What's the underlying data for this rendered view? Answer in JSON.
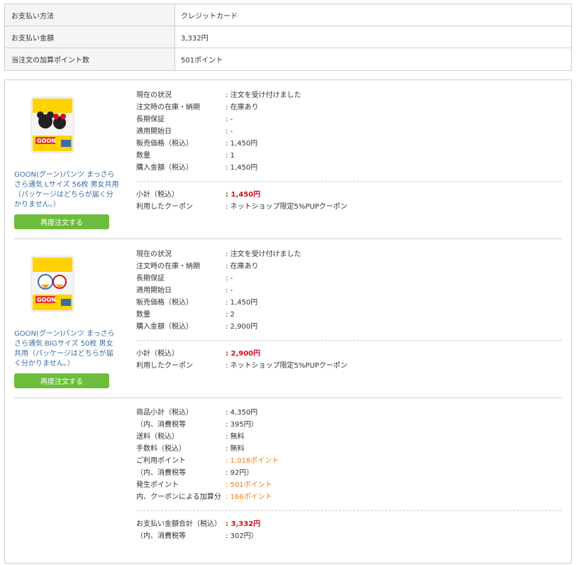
{
  "payment": [
    {
      "label": "お支払い方法",
      "value": "クレジットカード"
    },
    {
      "label": "お支払い金額",
      "value": "3,332円"
    },
    {
      "label": "当注文の加算ポイント数",
      "value": "501ポイント"
    }
  ],
  "items": [
    {
      "name": "GOON(グーン)パンツ まっさらさら通気 Lサイズ 56枚 男女共用（パッケージはどちらが届く分かりません。）",
      "reorder": "再度注文する",
      "rows": [
        {
          "label": "現在の状況",
          "value": ": 注文を受け付けました"
        },
        {
          "label": "注文時の在庫・納期",
          "value": ": 在庫あり"
        },
        {
          "label": "長期保証",
          "value": ": -"
        },
        {
          "label": "適用開始日",
          "value": ": -"
        },
        {
          "label": "販売価格（税込）",
          "value": ": 1,450円"
        },
        {
          "label": "数量",
          "value": ": 1"
        },
        {
          "label": "購入金額（税込）",
          "value": ": 1,450円"
        }
      ],
      "subtotal_label": "小計（税込）",
      "subtotal_value": ": 1,450円",
      "coupon_label": "利用したクーポン",
      "coupon_value": ": ネットショップ限定5%PUPクーポン"
    },
    {
      "name": "GOON(グーン)パンツ まっさらさら通気 BIGサイズ 50枚 男女共用（パッケージはどちらが届く分かりません。）",
      "reorder": "再度注文する",
      "rows": [
        {
          "label": "現在の状況",
          "value": ": 注文を受け付けました"
        },
        {
          "label": "注文時の在庫・納期",
          "value": ": 在庫あり"
        },
        {
          "label": "長期保証",
          "value": ": -"
        },
        {
          "label": "適用開始日",
          "value": ": -"
        },
        {
          "label": "販売価格（税込）",
          "value": ": 1,450円"
        },
        {
          "label": "数量",
          "value": ": 2"
        },
        {
          "label": "購入金額（税込）",
          "value": ": 2,900円"
        }
      ],
      "subtotal_label": "小計（税込）",
      "subtotal_value": ": 2,900円",
      "coupon_label": "利用したクーポン",
      "coupon_value": ": ネットショップ限定5%PUPクーポン"
    }
  ],
  "summary": {
    "rows": [
      {
        "label": "商品小計（税込）",
        "value": ": 4,350円"
      },
      {
        "label": "（内、消費税等",
        "value": ": 395円）"
      },
      {
        "label": "送料（税込）",
        "value": ": 無料"
      },
      {
        "label": "手数料（税込）",
        "value": ": 無料"
      },
      {
        "label": "ご利用ポイント",
        "value": ": 1,018ポイント"
      },
      {
        "label": "（内、消費税等",
        "value": ": 92円）"
      },
      {
        "label": "発生ポイント",
        "value": ": 501ポイント"
      },
      {
        "label": "内、クーポンによる加算分",
        "value": ": 166ポイント"
      }
    ],
    "total_label": "お支払い金額合計（税込）",
    "total_value": ": 3,332円",
    "total_tax_label": "（内、消費税等",
    "total_tax_value": ": 302円）"
  },
  "colors": {
    "link": "#3a6ea8",
    "button": "#6cbd3b",
    "price": "#d0121b",
    "points": "#e8821e"
  }
}
